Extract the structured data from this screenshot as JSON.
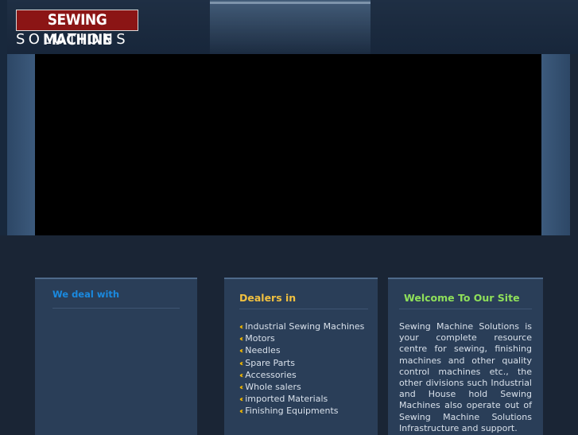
{
  "logo": {
    "line1": "SEWING MACHINE",
    "line2": "SOLUTIONS"
  },
  "sections": {
    "deal": {
      "title": "We deal with"
    },
    "dealers": {
      "title": "Dealers in",
      "items": [
        "Industrial Sewing Machines",
        "Motors",
        "Needles",
        "Spare Parts",
        "Accessories",
        "Whole salers",
        "imported Materials",
        "Finishing Equipments"
      ],
      "bullet_icon": "double-chevron-left-icon"
    },
    "welcome": {
      "title": "Welcome To Our Site",
      "body": "Sewing Machine Solutions is your complete resource centre for sewing, finishing machines and other quality control machines etc., the other divisions such Industrial and House hold Sewing Machines also operate out of Sewing Machine Solutions Infrastructure and support."
    }
  },
  "colors": {
    "background": "#1a2535",
    "panel": "#2a3e58",
    "logo_red": "#8b1515",
    "deal_title": "#1a8ae0",
    "dealers_title": "#f0c040",
    "welcome_title": "#8fe05a",
    "bullet": "#f2b800"
  }
}
